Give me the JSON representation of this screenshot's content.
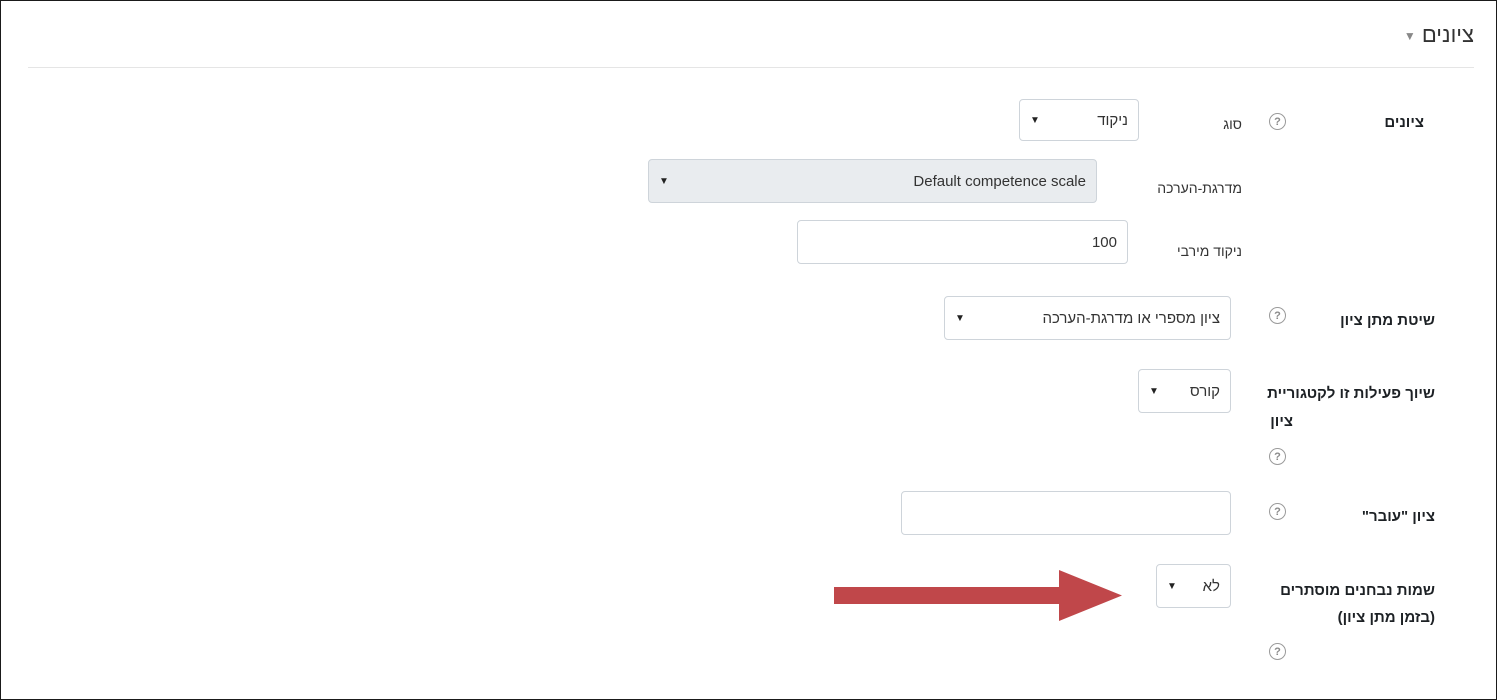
{
  "section": {
    "title": "ציונים",
    "toggle_icon": "▼"
  },
  "grade": {
    "label": "ציונים",
    "type_label": "סוג",
    "type_value": "ניקוד",
    "scale_label": "מדרגת-הערכה",
    "scale_value": "Default competence scale",
    "max_label": "ניקוד מירבי",
    "max_value": "100"
  },
  "grading_method": {
    "label": "שיטת מתן ציון",
    "value": "ציון מספרי או מדרגת-הערכה"
  },
  "grade_category": {
    "label_line1": "שיוך פעילות זו לקטגוריית",
    "label_line2": "ציון",
    "value": "קורס"
  },
  "pass_grade": {
    "label": "ציון \"עובר\"",
    "value": ""
  },
  "blind_marking": {
    "label_line1": "שמות נבחנים מוסתרים",
    "label_line2": "(בזמן מתן ציון)",
    "value": "לא"
  },
  "icons": {
    "help": "?",
    "caret": "▼"
  },
  "colors": {
    "arrow": "#c0474a",
    "border": "#ced4da",
    "disabled_bg": "#e9ecef"
  }
}
